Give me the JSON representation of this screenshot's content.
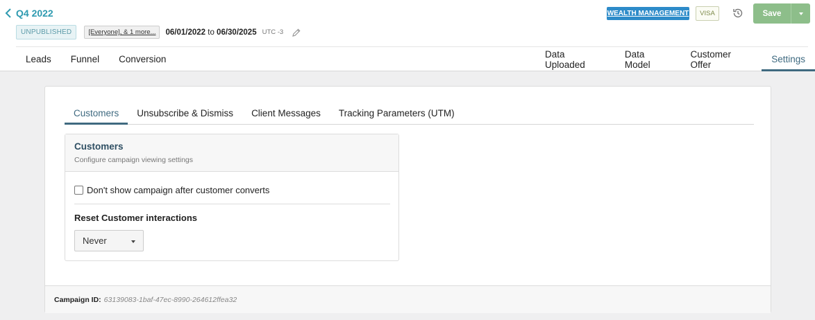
{
  "header": {
    "title": "Q4 2022",
    "status_badge": "UNPUBLISHED",
    "audience": "[Everyone], & 1 more...",
    "start_date": "06/01/2022",
    "date_separator": "to",
    "end_date": "06/30/2025",
    "timezone": "UTC -3",
    "tag_primary": "WEALTH MANAGEMENT",
    "tag_secondary": "VISA",
    "save_label": "Save",
    "icons": {
      "back": "chevron-left-icon",
      "edit": "pencil-icon",
      "history": "history-icon",
      "dropdown": "caret-down-icon"
    }
  },
  "nav": {
    "left": [
      "Leads",
      "Funnel",
      "Conversion"
    ],
    "right": [
      "Data Uploaded",
      "Data Model",
      "Customer Offer",
      "Settings"
    ],
    "active": "Settings"
  },
  "settings": {
    "tabs": [
      "Customers",
      "Unsubscribe & Dismiss",
      "Client Messages",
      "Tracking Parameters (UTM)"
    ],
    "active_tab": "Customers",
    "panel": {
      "title": "Customers",
      "subtitle": "Configure campaign viewing settings",
      "checkbox_label": "Don't show campaign after customer converts",
      "checkbox_checked": false,
      "reset_label": "Reset Customer interactions",
      "reset_value": "Never"
    }
  },
  "footer": {
    "label": "Campaign ID:",
    "value": "63139083-1baf-47ec-8990-264612ffea32"
  },
  "colors": {
    "accent": "#3f6a80",
    "title_teal": "#2e9ab0",
    "wealth_tag": "#2d8bc9",
    "save_green": "#8dbe8a"
  }
}
